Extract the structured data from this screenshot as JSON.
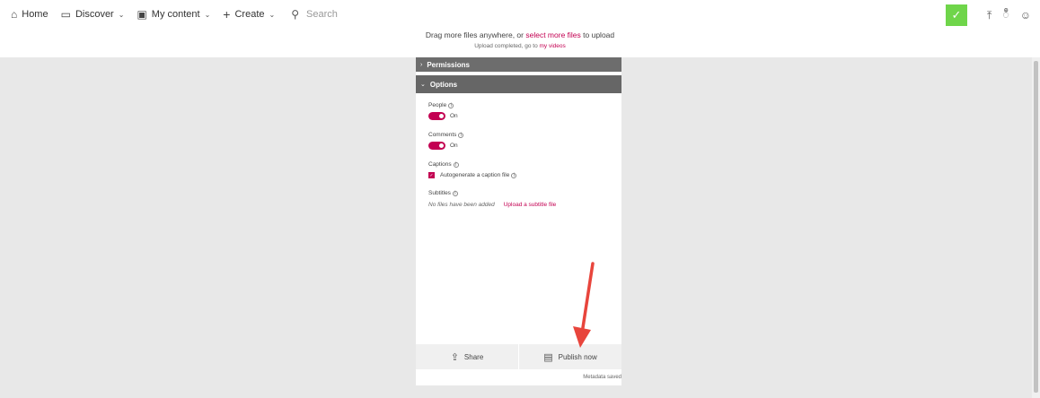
{
  "nav": {
    "home": "Home",
    "discover": "Discover",
    "my_content": "My content",
    "create": "Create",
    "search_placeholder": "Search"
  },
  "upload": {
    "drag_prefix": "Drag more files anywhere, or",
    "select_link": "select more files",
    "drag_suffix": "to upload",
    "completed_prefix": "Upload completed, go to",
    "my_videos_link": "my videos"
  },
  "panel": {
    "permissions_header": "Permissions",
    "options_header": "Options",
    "people_label": "People",
    "people_state": "On",
    "comments_label": "Comments",
    "comments_state": "On",
    "captions_label": "Captions",
    "autogenerate_label": "Autogenerate a caption file",
    "subtitles_label": "Subtitles",
    "no_files": "No files have been added",
    "upload_subtitle": "Upload a subtitle file"
  },
  "footer": {
    "share": "Share",
    "publish": "Publish now",
    "metadata_saved": "Metadata saved"
  },
  "colors": {
    "accent": "#c30052",
    "check_green": "#6fd54a",
    "header_gray": "#6d6d6d",
    "annotation_arrow": "#e8453c"
  }
}
